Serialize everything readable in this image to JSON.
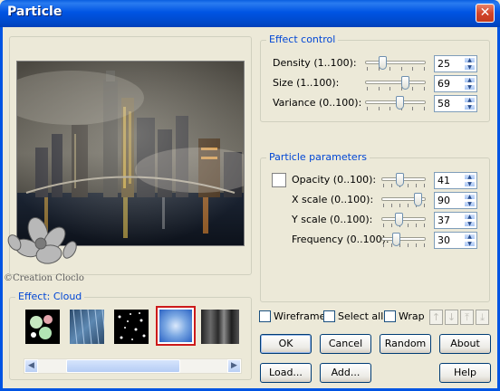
{
  "window": {
    "title": "Particle",
    "close_glyph": "✕"
  },
  "effect_control": {
    "legend": "Effect control",
    "rows": [
      {
        "label": "Density (1..100):",
        "value": "25",
        "level": 0.25
      },
      {
        "label": "Size (1..100):",
        "value": "69",
        "level": 0.69
      },
      {
        "label": "Variance (0..100):",
        "value": "58",
        "level": 0.58
      }
    ]
  },
  "particle_parameters": {
    "legend": "Particle parameters",
    "rows": [
      {
        "label": "Opacity (0..100):",
        "value": "41",
        "level": 0.41
      },
      {
        "label": "X scale (0..100):",
        "value": "90",
        "level": 0.9
      },
      {
        "label": "Y scale (0..100):",
        "value": "37",
        "level": 0.37
      },
      {
        "label": "Frequency (0..100):",
        "value": "30",
        "level": 0.3
      }
    ]
  },
  "preview": {
    "watermark": "©Creation Cloclo"
  },
  "effect_strip": {
    "legend": "Effect: Cloud",
    "selected_index": 3,
    "thumbnails": [
      "bubbles",
      "rain",
      "stars",
      "cloud",
      "smoke"
    ]
  },
  "options": {
    "wireframe": "Wireframe",
    "select_all": "Select all",
    "wrap": "Wrap"
  },
  "buttons": {
    "ok": "OK",
    "cancel": "Cancel",
    "random": "Random",
    "about": "About",
    "load": "Load...",
    "add": "Add...",
    "help": "Help"
  },
  "icons": {
    "move_up": "up-arrow-icon",
    "move_down": "down-arrow-icon",
    "move_top": "top-arrow-icon",
    "move_bottom": "bottom-arrow-icon"
  },
  "colors": {
    "title_bar": "#0054e3",
    "legend_text": "#0046d5",
    "selected_border": "#cc1a1a"
  }
}
